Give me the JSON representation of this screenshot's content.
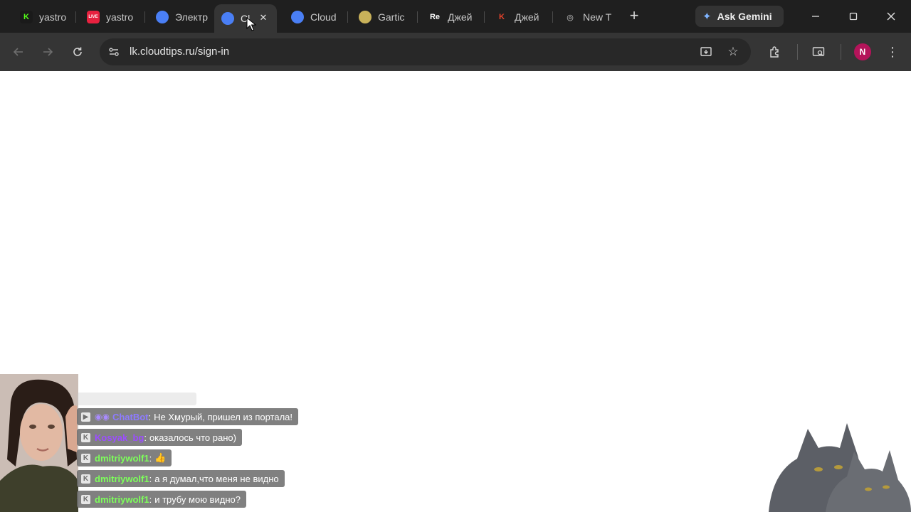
{
  "browser": {
    "tabs": [
      {
        "title": "yastro",
        "favicon_color": "#1a1a1a",
        "favicon_text": "K",
        "favicon_text_color": "#53fc18",
        "active": false
      },
      {
        "title": "yastro",
        "favicon_color": "#e8213f",
        "favicon_text": "LIVE",
        "favicon_text_color": "#ffffff",
        "active": false
      },
      {
        "title": "Электр",
        "favicon_color": "#4a7ff5",
        "favicon_text": "",
        "favicon_text_color": "#ffffff",
        "active": false
      },
      {
        "title": "Cl",
        "favicon_color": "#4a7ff5",
        "favicon_text": "",
        "favicon_text_color": "#ffffff",
        "active": true
      },
      {
        "title": "Cloud",
        "favicon_color": "#4a7ff5",
        "favicon_text": "",
        "favicon_text_color": "#ffffff",
        "active": false
      },
      {
        "title": "Gartic",
        "favicon_color": "#c9b25a",
        "favicon_text": "",
        "favicon_text_color": "#ffffff",
        "active": false
      },
      {
        "title": "Джей",
        "favicon_color": "#1f1f1f",
        "favicon_text": "Re",
        "favicon_text_color": "#ffffff",
        "active": false
      },
      {
        "title": "Джей",
        "favicon_color": "#1f1f1f",
        "favicon_text": "K",
        "favicon_text_color": "#e8432b",
        "active": false
      },
      {
        "title": "New T",
        "favicon_color": "#1f1f1f",
        "favicon_text": "◎",
        "favicon_text_color": "#cfcfcf",
        "active": false
      }
    ],
    "gemini_label": "Ask Gemini",
    "url": "lk.cloudtips.ru/sign-in",
    "profile_initial": "N"
  },
  "chat": {
    "messages": [
      {
        "user": "ChatBot",
        "text": "Не Хмурый, пришел из портала!",
        "user_color": "#8d7bff",
        "bot": true
      },
      {
        "user": "Kosyak_bg",
        "text": "оказалось что рано)",
        "user_color": "#9b4dff",
        "bot": false
      },
      {
        "user": "dmitriywolf1",
        "text": "👍",
        "user_color": "#7dff5a",
        "bot": false
      },
      {
        "user": "dmitriywolf1",
        "text": "а я думал,что меня не видно",
        "user_color": "#7dff5a",
        "bot": false
      },
      {
        "user": "dmitriywolf1",
        "text": "и трубу мою видно?",
        "user_color": "#7dff5a",
        "bot": false
      }
    ]
  }
}
